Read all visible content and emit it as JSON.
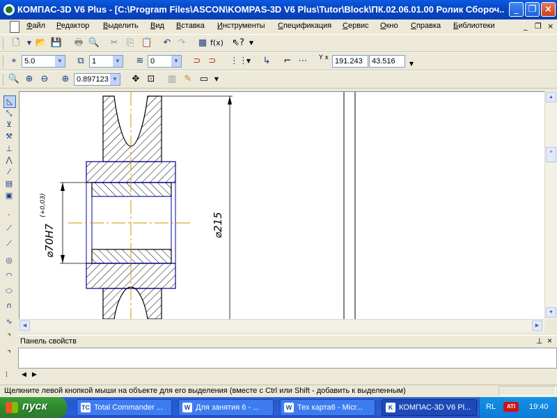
{
  "window": {
    "title": "КОМПАС-3D V6 Plus - [C:\\Program Files\\ASCON\\KOMPAS-3D V6 Plus\\Tutor\\Block\\ПК.02.06.01.00 Ролик Сбороч...",
    "buttons": [
      "_",
      "❐",
      "×"
    ]
  },
  "menu": {
    "items": [
      "Файл",
      "Редактор",
      "Выделить",
      "Вид",
      "Вставка",
      "Инструменты",
      "Спецификация",
      "Сервис",
      "Окно",
      "Справка",
      "Библиотеки"
    ],
    "underline": [
      "Ф",
      "Р",
      "В",
      "В",
      "В",
      "И",
      "С",
      "С",
      "О",
      "С",
      "Б"
    ]
  },
  "toolbar1": {
    "icons": [
      "new-file-icon",
      "open-folder-icon",
      "save-icon",
      "print-icon",
      "print-preview-icon",
      "cut-icon",
      "copy-icon",
      "paste-icon",
      "undo-icon",
      "redo-icon",
      "manager-icon",
      "function-icon",
      "help-icon"
    ],
    "fx_label": "f(x)"
  },
  "toolbar2": {
    "step_value": "5.0",
    "layer_value": "1",
    "style_value": "0",
    "coord_label": "Y x",
    "x_coord": "191.243",
    "y_coord": "43.516"
  },
  "toolbar3": {
    "zoom_value": "0.897123"
  },
  "drawing": {
    "dim_bore": "⌀70H7",
    "dim_bore_tolerance": "(+0,03)",
    "dim_outer": "⌀215"
  },
  "properties_panel": {
    "title": "Панель свойств",
    "pin": "⊥",
    "close": "×"
  },
  "status": {
    "message": "Щелкните левой кнопкой мыши на объекте для его выделения (вместе с Ctrl или Shift - добавить к выделенным)"
  },
  "taskbar": {
    "start_label": "пуск",
    "tasks": [
      {
        "label": "Total Commander ...",
        "icon": "TC"
      },
      {
        "label": "Для занятия 6 - ...",
        "icon": "W"
      },
      {
        "label": "Тех карта6 - Micr...",
        "icon": "W"
      },
      {
        "label": "КОМПАС-3D V6 Pl...",
        "icon": "K"
      }
    ],
    "active_task": 3,
    "lang": "RL",
    "tray_label": "ATI",
    "time": "19:40"
  }
}
